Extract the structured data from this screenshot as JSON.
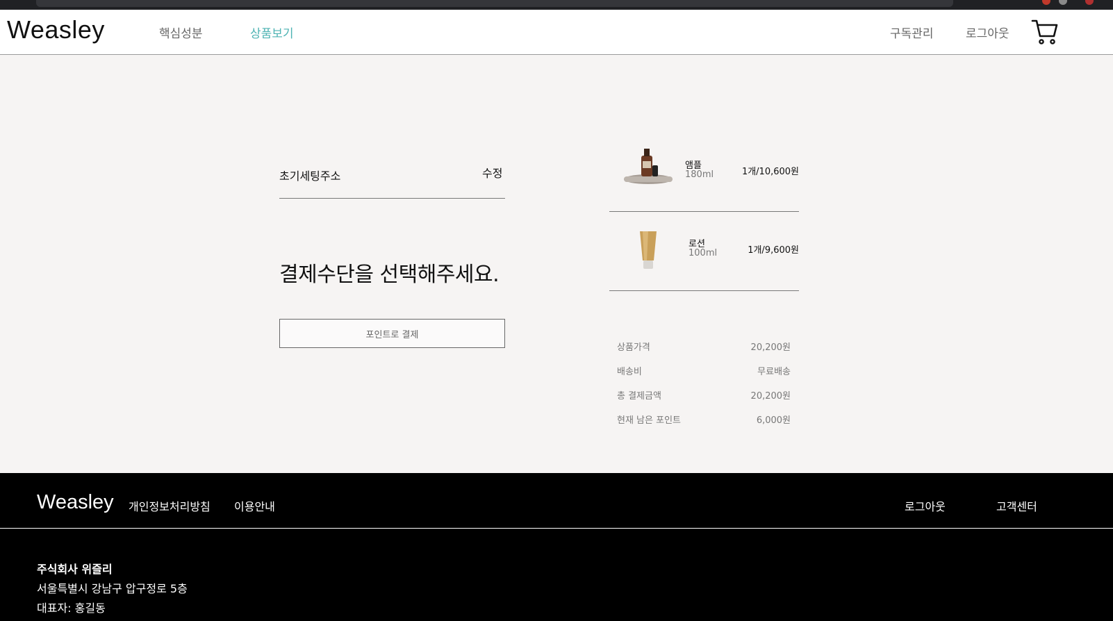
{
  "header": {
    "logo": "Weasley",
    "nav": [
      {
        "label": "핵심성분",
        "active": false
      },
      {
        "label": "상품보기",
        "active": true
      }
    ],
    "right": {
      "subscription": "구독관리",
      "logout": "로그아웃"
    },
    "icons": {
      "cart": "cart-icon"
    }
  },
  "checkout": {
    "address_label": "초기세팅주소",
    "edit_label": "수정",
    "payment_title": "결제수단을 선택해주세요.",
    "point_pay_button": "포인트로 결제"
  },
  "cart": {
    "items": [
      {
        "name": "앰플",
        "volume": "180ml",
        "price": "1개/10,600원"
      },
      {
        "name": "로션",
        "volume": "100ml",
        "price": "1개/9,600원"
      }
    ],
    "summary": [
      {
        "label": "상품가격",
        "value": "20,200원"
      },
      {
        "label": "배송비",
        "value": "무료배송"
      },
      {
        "label": "총 결제금액",
        "value": "20,200원"
      },
      {
        "label": "현재 남은 포인트",
        "value": "6,000원"
      }
    ]
  },
  "footer": {
    "logo": "Weasley",
    "links": [
      "개인정보처리방침",
      "이용안내"
    ],
    "right_links": [
      "로그아웃",
      "고객센터"
    ],
    "company": "주식회사 위즐리",
    "address": "서울특별시 강남구 압구정로 5층",
    "ceo": "대표자: 홍길동"
  },
  "colors": {
    "accent": "#4db3b3",
    "background": "#f6f4f3",
    "footer": "#000000"
  }
}
